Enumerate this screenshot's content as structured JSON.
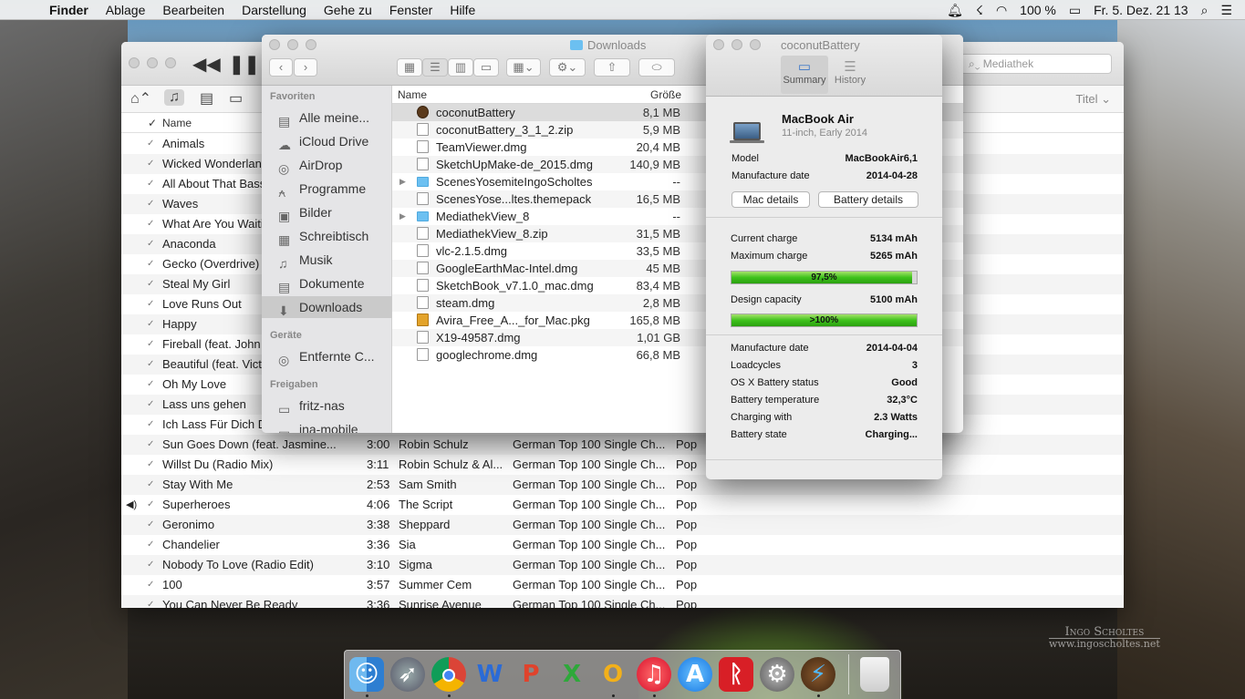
{
  "menubar": {
    "app": "Finder",
    "items": [
      "Ablage",
      "Bearbeiten",
      "Darstellung",
      "Gehe zu",
      "Fenster",
      "Hilfe"
    ],
    "battery": "100 %",
    "datetime": "Fr. 5. Dez.  21 13"
  },
  "itunes": {
    "search_placeholder": "Mediathek",
    "sort_label": "Titel",
    "col_name": "Name",
    "rows": [
      {
        "title": "Animals",
        "time": "",
        "artist": "",
        "album": "",
        "genre": ""
      },
      {
        "title": "Wicked Wonderland",
        "time": "",
        "artist": "",
        "album": "",
        "genre": ""
      },
      {
        "title": "All About That Bass",
        "time": "",
        "artist": "",
        "album": "",
        "genre": ""
      },
      {
        "title": "Waves",
        "time": "",
        "artist": "",
        "album": "",
        "genre": ""
      },
      {
        "title": "What Are You Waiting For",
        "time": "",
        "artist": "",
        "album": "",
        "genre": ""
      },
      {
        "title": "Anaconda",
        "time": "",
        "artist": "",
        "album": "",
        "genre": ""
      },
      {
        "title": "Gecko (Overdrive) [",
        "time": "",
        "artist": "",
        "album": "",
        "genre": ""
      },
      {
        "title": "Steal My Girl",
        "time": "",
        "artist": "",
        "album": "",
        "genre": ""
      },
      {
        "title": "Love Runs Out",
        "time": "",
        "artist": "",
        "album": "",
        "genre": ""
      },
      {
        "title": "Happy",
        "time": "",
        "artist": "",
        "album": "",
        "genre": ""
      },
      {
        "title": "Fireball (feat. John",
        "time": "",
        "artist": "",
        "album": "",
        "genre": ""
      },
      {
        "title": "Beautiful (feat. Victoria",
        "time": "",
        "artist": "",
        "album": "",
        "genre": ""
      },
      {
        "title": "Oh My Love",
        "time": "",
        "artist": "",
        "album": "",
        "genre": ""
      },
      {
        "title": "Lass uns gehen",
        "time": "",
        "artist": "",
        "album": "",
        "genre": ""
      },
      {
        "title": "Ich Lass Für Dich D",
        "time": "",
        "artist": "",
        "album": "",
        "genre": ""
      },
      {
        "title": "Sun Goes Down (feat. Jasmine...",
        "time": "3:00",
        "artist": "Robin Schulz",
        "album": "German Top 100 Single Ch...",
        "genre": "Pop"
      },
      {
        "title": "Willst Du (Radio Mix)",
        "time": "3:11",
        "artist": "Robin Schulz & Al...",
        "album": "German Top 100 Single Ch...",
        "genre": "Pop"
      },
      {
        "title": "Stay With Me",
        "time": "2:53",
        "artist": "Sam Smith",
        "album": "German Top 100 Single Ch...",
        "genre": "Pop"
      },
      {
        "title": "Superheroes",
        "time": "4:06",
        "artist": "The Script",
        "album": "German Top 100 Single Ch...",
        "genre": "Pop",
        "playing": true
      },
      {
        "title": "Geronimo",
        "time": "3:38",
        "artist": "Sheppard",
        "album": "German Top 100 Single Ch...",
        "genre": "Pop"
      },
      {
        "title": "Chandelier",
        "time": "3:36",
        "artist": "Sia",
        "album": "German Top 100 Single Ch...",
        "genre": "Pop"
      },
      {
        "title": "Nobody To Love (Radio Edit)",
        "time": "3:10",
        "artist": "Sigma",
        "album": "German Top 100 Single Ch...",
        "genre": "Pop"
      },
      {
        "title": "100",
        "time": "3:57",
        "artist": "Summer Cem",
        "album": "German Top 100 Single Ch...",
        "genre": "Pop"
      },
      {
        "title": "You Can Never Be Ready",
        "time": "3:36",
        "artist": "Sunrise Avenue",
        "album": "German Top 100 Single Ch...",
        "genre": "Pop"
      }
    ]
  },
  "finder": {
    "title": "Downloads",
    "col_name": "Name",
    "col_size": "Größe",
    "sidebar": {
      "favorites_label": "Favoriten",
      "favorites": [
        "Alle meine...",
        "iCloud Drive",
        "AirDrop",
        "Programme",
        "Bilder",
        "Schreibtisch",
        "Musik",
        "Dokumente",
        "Downloads"
      ],
      "devices_label": "Geräte",
      "devices": [
        "Entfernte C..."
      ],
      "shares_label": "Freigaben",
      "shares": [
        "fritz-nas",
        "ina-mobile"
      ]
    },
    "files": [
      {
        "name": "coconutBattery",
        "size": "8,1 MB",
        "kind": "app",
        "selected": true
      },
      {
        "name": "coconutBattery_3_1_2.zip",
        "size": "5,9 MB",
        "kind": "doc"
      },
      {
        "name": "TeamViewer.dmg",
        "size": "20,4 MB",
        "kind": "doc"
      },
      {
        "name": "SketchUpMake-de_2015.dmg",
        "size": "140,9 MB",
        "kind": "doc"
      },
      {
        "name": "ScenesYosemiteIngoScholtes",
        "size": "--",
        "kind": "folder"
      },
      {
        "name": "ScenesYose...ltes.themepack",
        "size": "16,5 MB",
        "kind": "doc"
      },
      {
        "name": "MediathekView_8",
        "size": "--",
        "kind": "folder"
      },
      {
        "name": "MediathekView_8.zip",
        "size": "31,5 MB",
        "kind": "doc"
      },
      {
        "name": "vlc-2.1.5.dmg",
        "size": "33,5 MB",
        "kind": "doc"
      },
      {
        "name": "GoogleEarthMac-Intel.dmg",
        "size": "45 MB",
        "kind": "doc"
      },
      {
        "name": "SketchBook_v7.1.0_mac.dmg",
        "size": "83,4 MB",
        "kind": "doc"
      },
      {
        "name": "steam.dmg",
        "size": "2,8 MB",
        "kind": "doc"
      },
      {
        "name": "Avira_Free_A..._for_Mac.pkg",
        "size": "165,8 MB",
        "kind": "pkg"
      },
      {
        "name": "X19-49587.dmg",
        "size": "1,01 GB",
        "kind": "doc"
      },
      {
        "name": "googlechrome.dmg",
        "size": "66,8 MB",
        "kind": "doc"
      }
    ]
  },
  "coconut": {
    "title": "coconutBattery",
    "tabs": [
      "Summary",
      "History"
    ],
    "device_name": "MacBook Air",
    "device_sub": "11-inch, Early 2014",
    "model_label": "Model",
    "model": "MacBookAir6,1",
    "mfg_label": "Manufacture date",
    "mfg": "2014-04-28",
    "btn_mac": "Mac details",
    "btn_battery": "Battery details",
    "current_label": "Current charge",
    "current": "5134 mAh",
    "max_label": "Maximum charge",
    "max": "5265 mAh",
    "charge_bar_text": "97,5%",
    "charge_fraction": 0.975,
    "design_label": "Design capacity",
    "design": "5100 mAh",
    "design_bar_text": ">100%",
    "design_fraction": 1.0,
    "details": [
      {
        "k": "Manufacture date",
        "v": "2014-04-04"
      },
      {
        "k": "Loadcycles",
        "v": "3"
      },
      {
        "k": "OS X Battery status",
        "v": "Good"
      },
      {
        "k": "Battery temperature",
        "v": "32,3°C"
      },
      {
        "k": "Charging with",
        "v": "2.3 Watts"
      },
      {
        "k": "Battery state",
        "v": "Charging..."
      }
    ]
  },
  "dock": {
    "apps": [
      "Finder",
      "Launchpad",
      "Chrome",
      "Word",
      "PowerPoint",
      "Excel",
      "Outlook",
      "iTunes",
      "App Store",
      "Avira",
      "Systemeinstellungen",
      "coconutBattery"
    ],
    "trash": "Papierkorb"
  },
  "watermark": {
    "line1": "Ingo Scholtes",
    "line2": "www.ingoscholtes.net"
  }
}
